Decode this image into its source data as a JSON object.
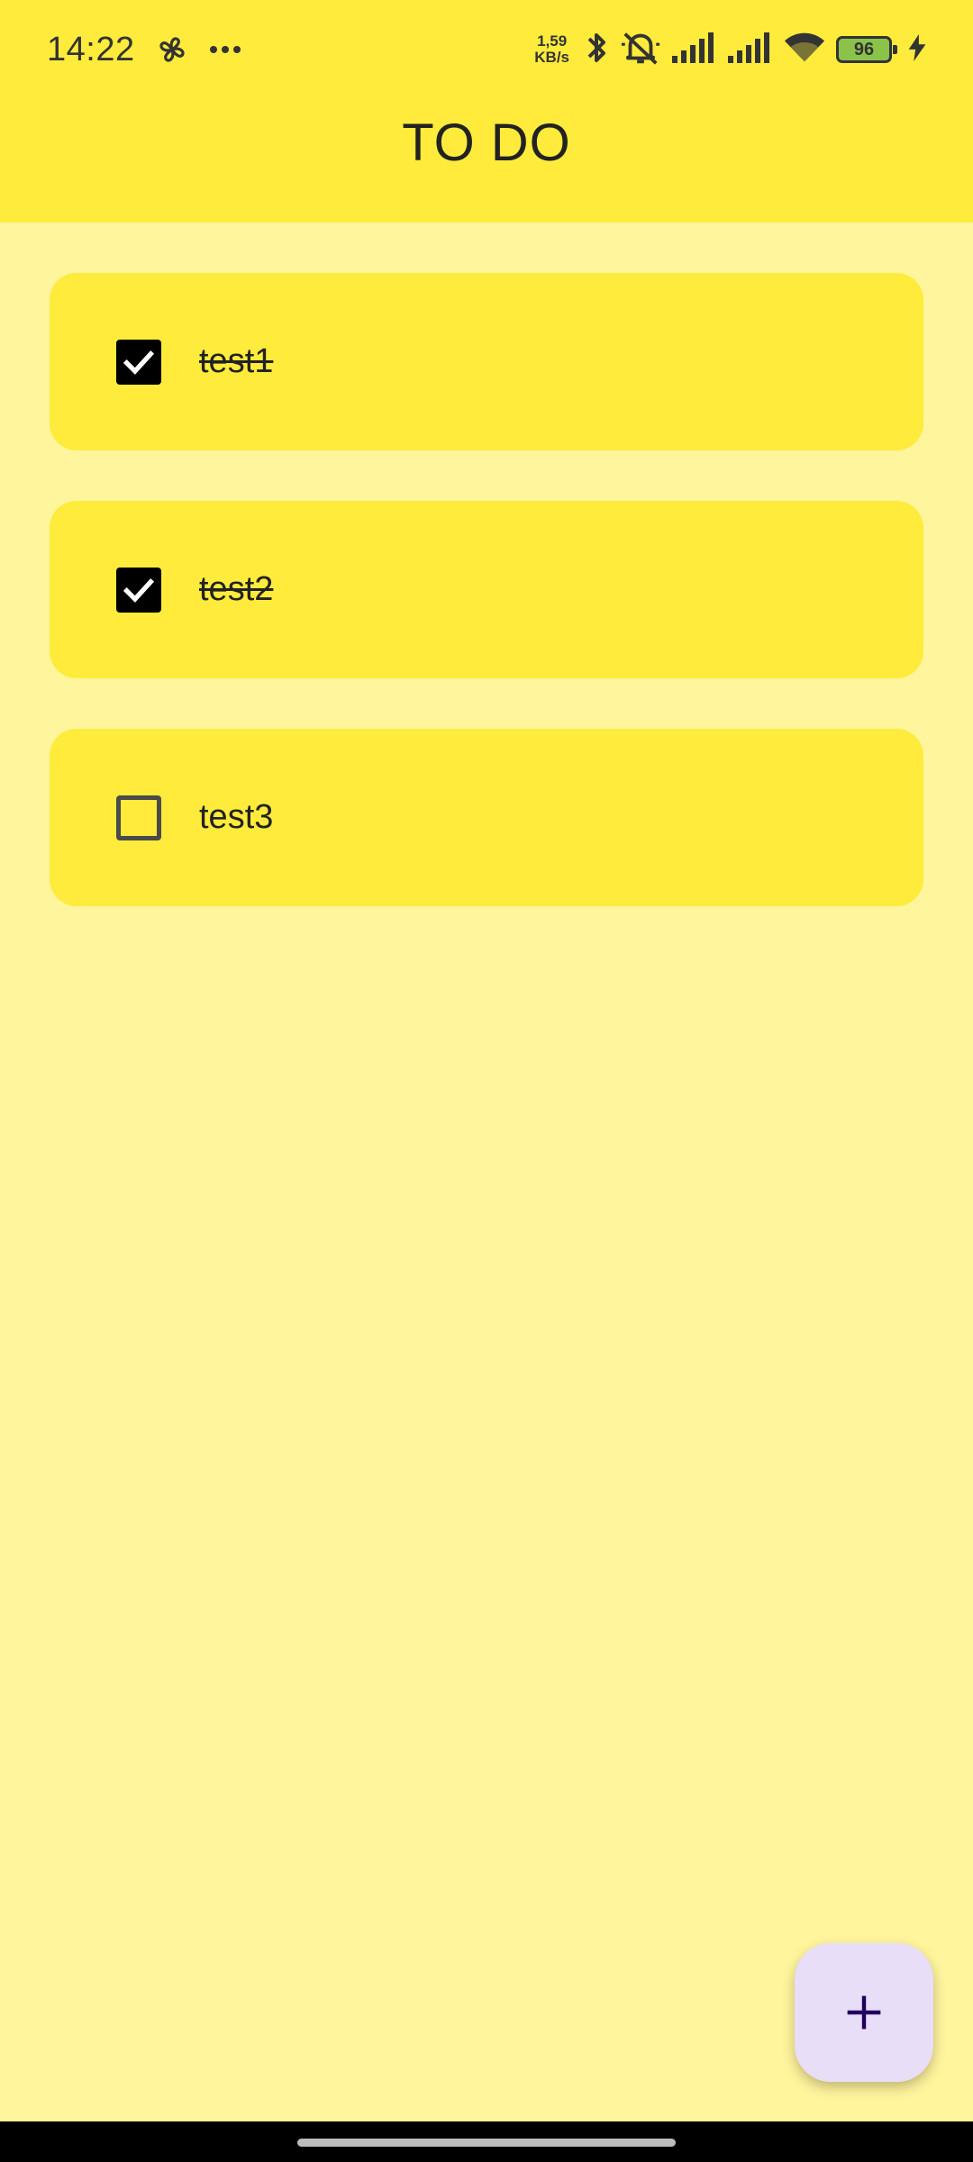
{
  "status_bar": {
    "time": "14:22",
    "left_icons": [
      "fan-icon",
      "more-dots-icon"
    ],
    "net_speed_value": "1,59",
    "net_speed_unit": "KB/s",
    "right_icons": [
      "bluetooth-icon",
      "muted-bell-icon",
      "signal-icon",
      "signal-icon",
      "wifi-icon",
      "battery-icon",
      "charging-icon"
    ],
    "battery_level": "96"
  },
  "header": {
    "title": "TO DO"
  },
  "tasks": [
    {
      "label": "test1",
      "checked": true
    },
    {
      "label": "test2",
      "checked": true
    },
    {
      "label": "test3",
      "checked": false
    }
  ],
  "fab": {
    "icon": "plus-icon"
  },
  "colors": {
    "app_bar": "#FFEB3B",
    "background": "#FFF59D",
    "card": "#FFEB3B",
    "fab": "#E8DEF8",
    "checkbox_checked": "#000000"
  }
}
